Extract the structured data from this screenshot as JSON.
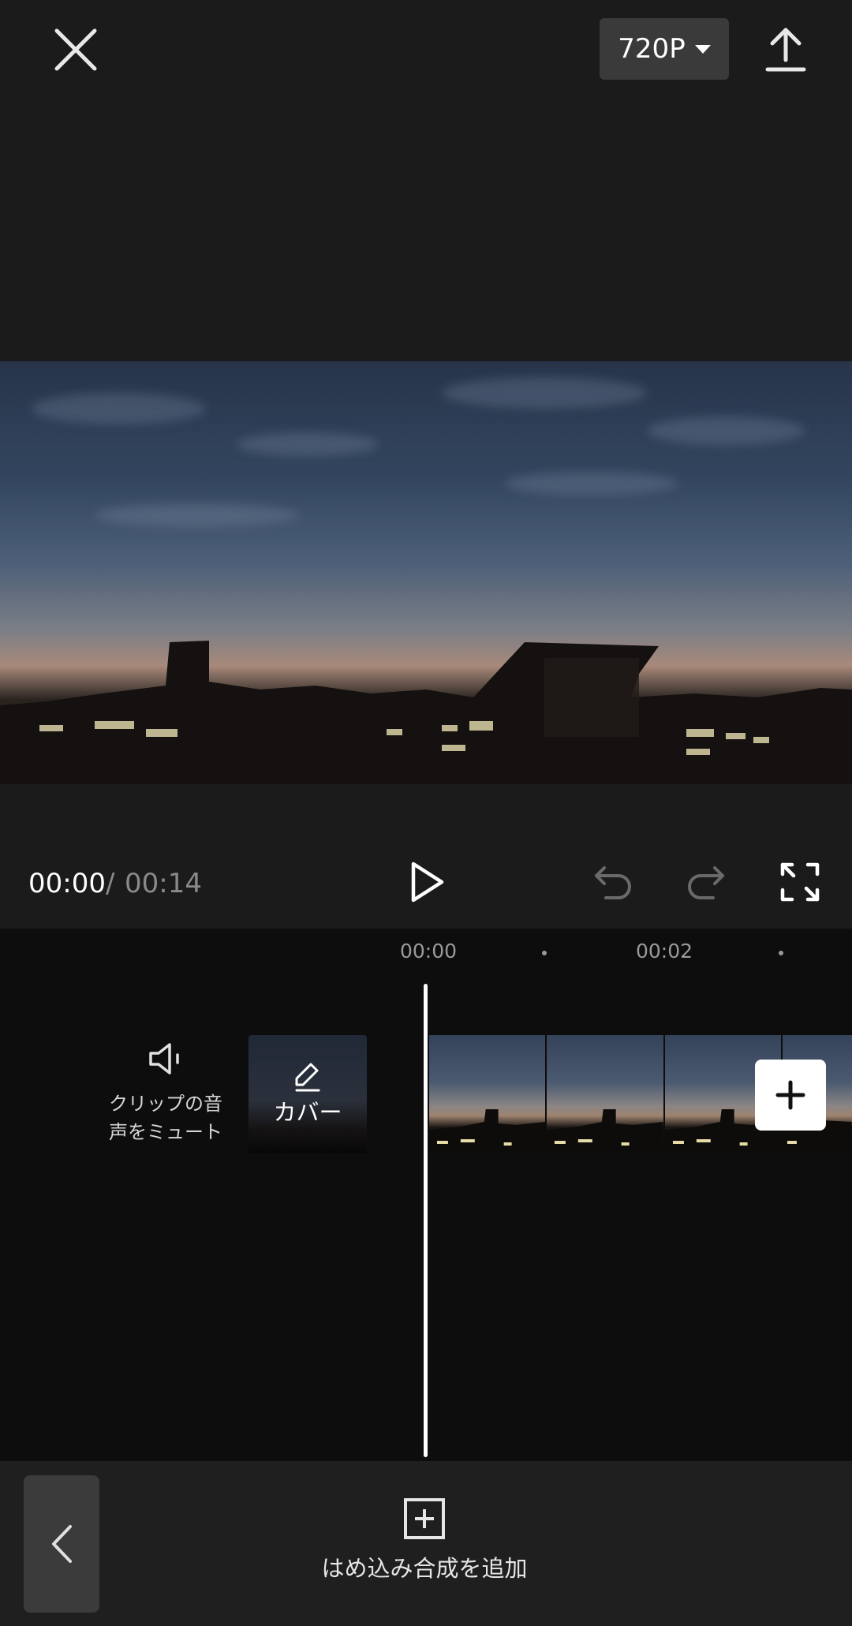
{
  "header": {
    "close_icon": "close-icon",
    "resolution_label": "720P",
    "export_icon": "upload-icon"
  },
  "player": {
    "current_time": "00:00",
    "separator": "/",
    "total_time": "00:14"
  },
  "timeline": {
    "ruler": [
      {
        "label": "00:00"
      },
      {
        "label": "00:02"
      }
    ],
    "mute_label": "クリップの音声をミュート",
    "cover_label": "カバー"
  },
  "bottom_bar": {
    "overlay_label": "はめ込み合成を追加"
  },
  "colors": {
    "background": "#1a1a1a",
    "timeline_background": "#0d0d0d",
    "bottom_bar": "#1f1f1f",
    "button_gray": "#3a3a3a",
    "accent_white": "#ffffff"
  }
}
